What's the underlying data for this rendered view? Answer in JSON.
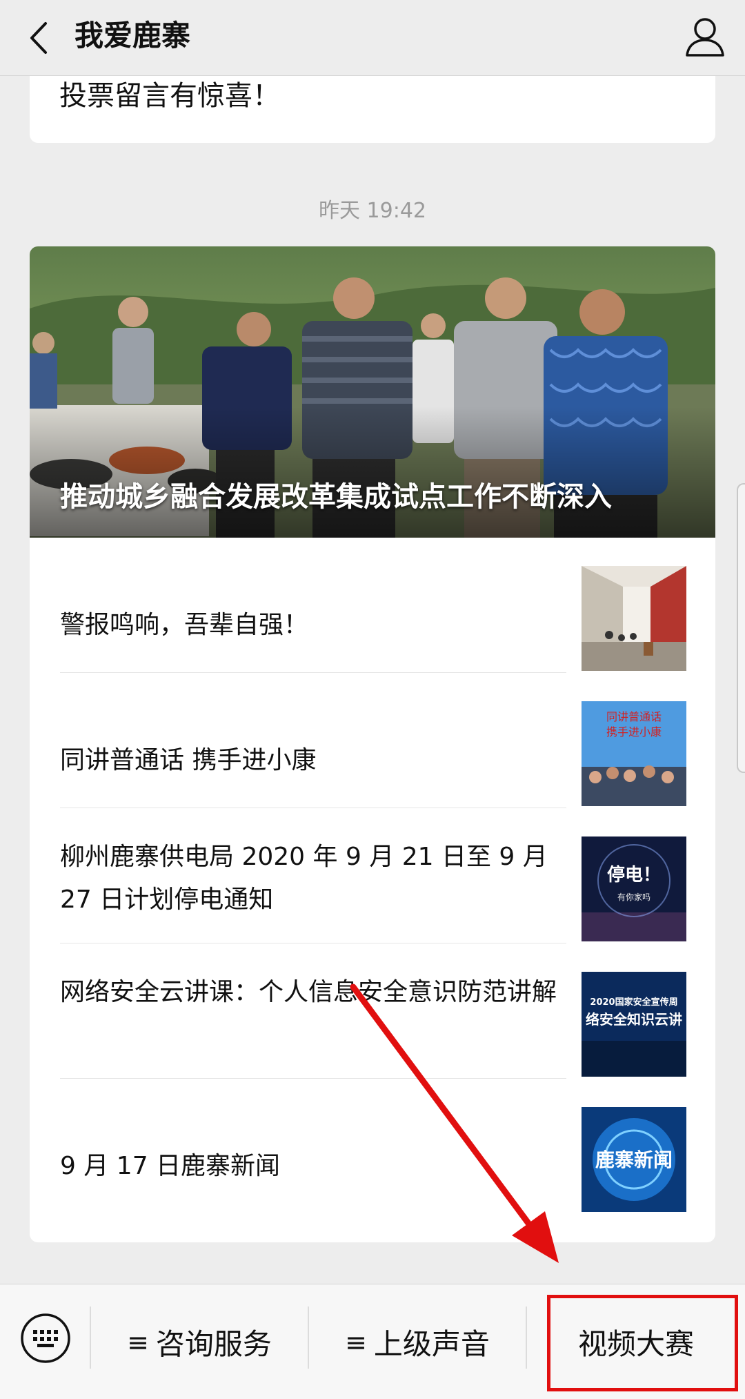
{
  "header": {
    "title": "我爱鹿寨",
    "back_icon": "chevron-left-icon",
    "profile_icon": "person-icon"
  },
  "previous_card": {
    "text": "投票留言有惊喜！"
  },
  "timestamp": "昨天 19:42",
  "news": {
    "cover_title": "推动城乡融合发展改革集成试点工作不断深入",
    "items": [
      {
        "title": "警报鸣响，吾辈自强！"
      },
      {
        "title": "同讲普通话 携手进小康",
        "thumb_text_1": "同讲普通话",
        "thumb_text_2": "携手进小康"
      },
      {
        "title": "柳州鹿寨供电局 2020 年 9 月 21 日至 9 月 27 日计划停电通知",
        "thumb_text_1": "停电！",
        "thumb_text_2": "有你家吗"
      },
      {
        "title": "网络安全云讲课：个人信息安全意识防范讲解",
        "thumb_text_1": "2020国家安全宣传周",
        "thumb_text_2": "络安全知识云讲"
      },
      {
        "title": "9 月 17 日鹿寨新闻",
        "thumb_text_1": "鹿寨新闻"
      }
    ]
  },
  "menu": {
    "keyboard_icon": "keyboard-icon",
    "items": [
      {
        "label": "咨询服务",
        "prefix": "≡"
      },
      {
        "label": "上级声音",
        "prefix": "≡"
      },
      {
        "label": "视频大赛"
      }
    ]
  },
  "annotation": {
    "arrow_color": "#e10f0f",
    "box_color": "#e10f0f"
  }
}
